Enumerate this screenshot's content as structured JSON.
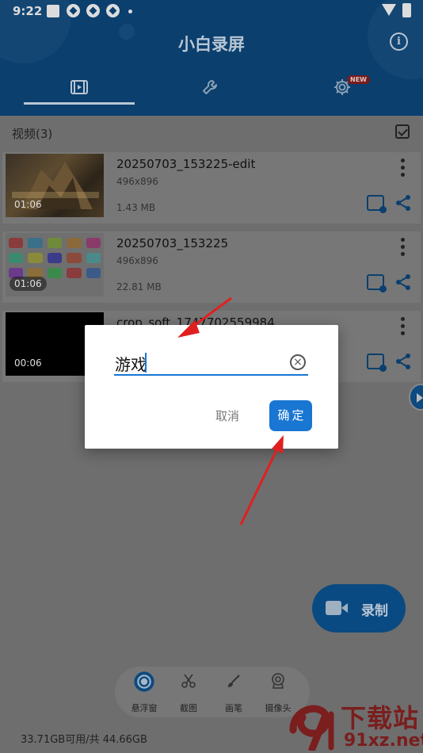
{
  "status_bar": {
    "time": "9:22"
  },
  "app": {
    "title": "小白录屏"
  },
  "tabs": [
    {
      "name": "videos",
      "icon": "video-icon",
      "selected": true
    },
    {
      "name": "tools",
      "icon": "wrench-icon",
      "selected": false
    },
    {
      "name": "settings",
      "icon": "gear-icon",
      "badge": "NEW",
      "selected": false
    }
  ],
  "list": {
    "header": "视频(3)",
    "items": [
      {
        "title": "20250703_153225-edit",
        "resolution": "496x896",
        "size": "1.43 MB",
        "duration": "01:06"
      },
      {
        "title": "20250703_153225",
        "resolution": "496x896",
        "size": "22.81 MB",
        "duration": "01:06"
      },
      {
        "title": "crop_soft_1747702559984",
        "duration": "00:06"
      }
    ]
  },
  "dialog": {
    "input_value": "游戏",
    "cancel_label": "取消",
    "confirm_label": "确定"
  },
  "record_button": {
    "label": "录制"
  },
  "toolbar": {
    "items": [
      {
        "label": "悬浮窗",
        "icon": "floating-window-icon"
      },
      {
        "label": "截图",
        "icon": "scissors-icon"
      },
      {
        "label": "画笔",
        "icon": "brush-icon"
      },
      {
        "label": "摄像头",
        "icon": "camera-icon"
      }
    ]
  },
  "footer": {
    "storage": "33.71GB可用/共 44.66GB"
  },
  "watermark": {
    "line1": "下载站",
    "line2": "91xz.net"
  },
  "colors": {
    "primary": "#1976d2",
    "header": "#0a3f6e",
    "overlay": "#6e6e6e",
    "arrow": "#e02020"
  }
}
